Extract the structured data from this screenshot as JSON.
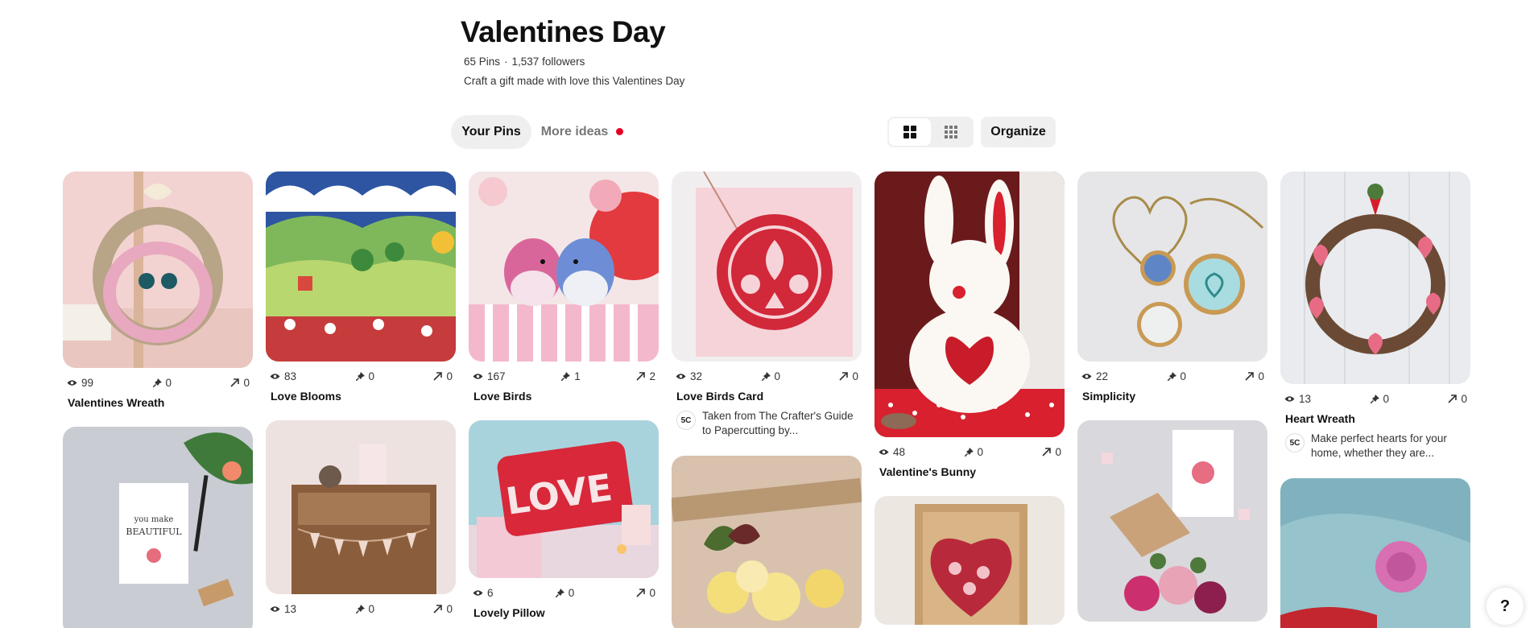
{
  "board": {
    "title": "Valentines Day",
    "pins_count": "65 Pins",
    "separator": "·",
    "followers": "1,537 followers",
    "description": "Craft a gift made with love this Valentines Day"
  },
  "toolbar": {
    "tab_your_pins": "Your Pins",
    "tab_more_ideas": "More ideas",
    "organize": "Organize",
    "view_default_icon": "grid-default-icon",
    "view_compact_icon": "grid-compact-icon"
  },
  "pins": [
    {
      "title": "Valentines Wreath",
      "views": "99",
      "saves": "0",
      "clicks": "0"
    },
    {
      "title": "Love Blooms",
      "views": "83",
      "saves": "0",
      "clicks": "0"
    },
    {
      "title": "Love Birds",
      "views": "167",
      "saves": "1",
      "clicks": "2"
    },
    {
      "title": "Love Birds Card",
      "views": "32",
      "saves": "0",
      "clicks": "0",
      "avatar": "5C",
      "description": "Taken from The Crafter's Guide to Papercutting by..."
    },
    {
      "title": "Valentine's Bunny",
      "views": "48",
      "saves": "0",
      "clicks": "0"
    },
    {
      "title": "Simplicity",
      "views": "22",
      "saves": "0",
      "clicks": "0"
    },
    {
      "title": "Heart Wreath",
      "views": "13",
      "saves": "0",
      "clicks": "0",
      "avatar": "5C",
      "description": "Make perfect hearts for your home, whether they are..."
    },
    {
      "title": "Lovely Pillow",
      "views": "6",
      "saves": "0",
      "clicks": "0"
    },
    {
      "views": "13",
      "saves": "0",
      "clicks": "0"
    }
  ],
  "help": {
    "label": "?"
  },
  "colors": {
    "accent": "#e60023",
    "chip_bg": "#efefef",
    "text": "#111111",
    "muted": "#767676"
  }
}
